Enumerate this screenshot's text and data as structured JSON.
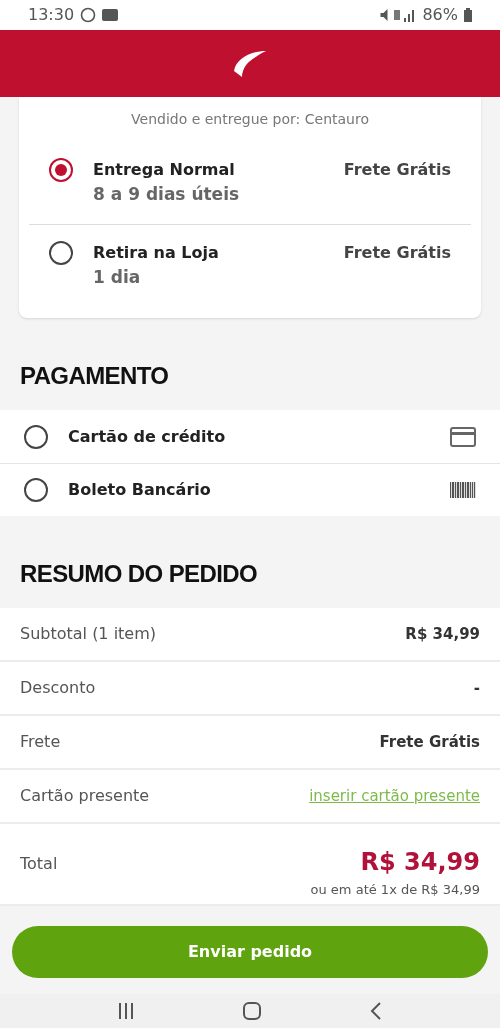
{
  "status_bar": {
    "time": "13:30",
    "battery": "86%"
  },
  "delivery": {
    "seller": "Vendido e entregue por: Centauro",
    "options": [
      {
        "name": "Entrega Normal",
        "time": "8 a 9 dias úteis",
        "price": "Frete Grátis",
        "selected": true
      },
      {
        "name": "Retira na Loja",
        "time": "1 dia",
        "price": "Frete Grátis",
        "selected": false
      }
    ]
  },
  "payment": {
    "title": "PAGAMENTO",
    "methods": [
      {
        "label": "Cartão de crédito",
        "kind": "card",
        "selected": false
      },
      {
        "label": "Boleto Bancário",
        "kind": "barcode",
        "selected": false
      }
    ]
  },
  "summary": {
    "title": "RESUMO DO PEDIDO",
    "rows": [
      {
        "label": "Subtotal (1 item)",
        "value": "R$ 34,99",
        "kind": "bold"
      },
      {
        "label": "Desconto",
        "value": "-",
        "kind": "bold"
      },
      {
        "label": "Frete",
        "value": "Frete Grátis",
        "kind": "bold"
      },
      {
        "label": "Cartão presente",
        "value": "inserir cartão presente",
        "kind": "link"
      },
      {
        "label": "Total",
        "value": "R$ 34,99",
        "note": "ou em até 1x de R$ 34,99",
        "kind": "total"
      }
    ]
  },
  "submit_button": "Enviar pedido"
}
